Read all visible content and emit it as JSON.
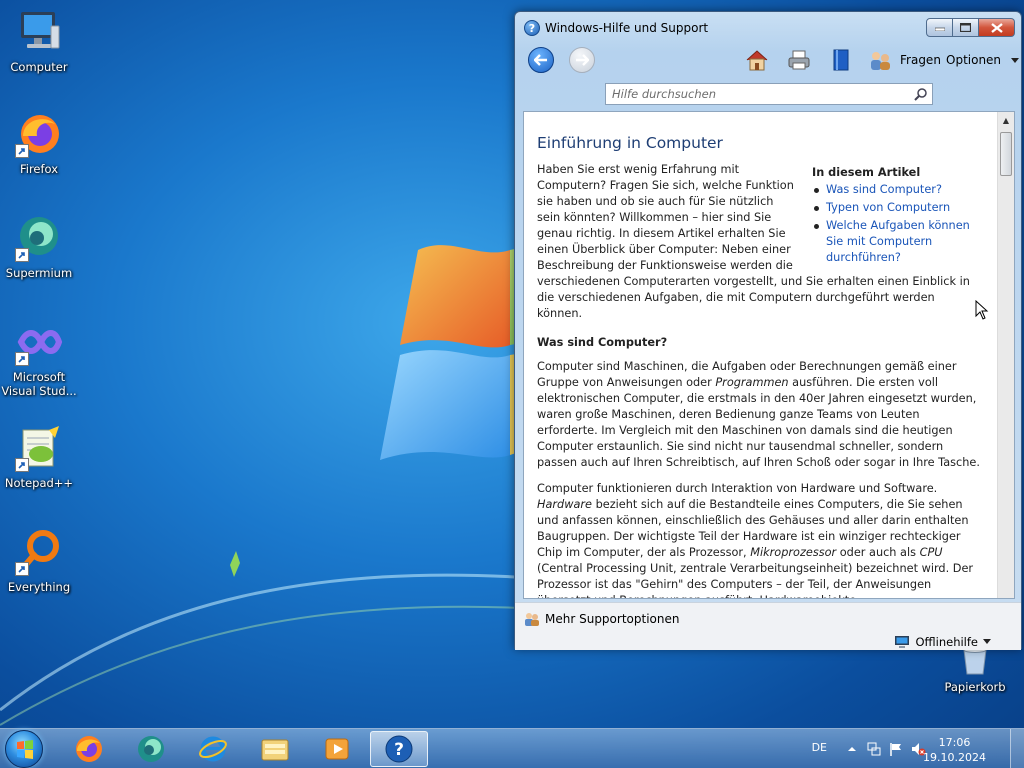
{
  "desktop": {
    "icons": [
      {
        "label": "Computer",
        "icon": "computer-icon"
      },
      {
        "label": "Firefox",
        "icon": "firefox-icon"
      },
      {
        "label": "Supermium",
        "icon": "supermium-icon"
      },
      {
        "label": "Microsoft Visual Stud...",
        "icon": "visual-studio-icon"
      },
      {
        "label": "Notepad++",
        "icon": "notepadpp-icon"
      },
      {
        "label": "Everything",
        "icon": "everything-icon"
      },
      {
        "label": "Papierkorb",
        "icon": "recycle-bin-icon"
      }
    ]
  },
  "window": {
    "title": "Windows-Hilfe und Support",
    "toolbar": {
      "fragen": "Fragen",
      "optionen": "Optionen"
    },
    "search": {
      "placeholder": "Hilfe durchsuchen"
    },
    "article": {
      "title": "Einführung in Computer",
      "intro": "Haben Sie erst wenig Erfahrung mit Computern? Fragen Sie sich, welche Funktion sie haben und ob sie auch für Sie nützlich sein könnten? Willkommen – hier sind Sie genau richtig. In diesem Artikel erhalten Sie einen Überblick über Computer: Neben einer Beschreibung der Funktionsweise werden die verschiedenen Computerarten vorgestellt, und Sie erhalten einen Einblick in die verschiedenen Aufgaben, die mit Computern durchgeführt werden können.",
      "toc_title": "In diesem Artikel",
      "toc": [
        "Was sind Computer?",
        "Typen von Computern",
        "Welche Aufgaben können Sie mit Computern durchführen?"
      ],
      "section1_title": "Was sind Computer?",
      "section1_p1_a": "Computer sind Maschinen, die Aufgaben oder Berechnungen gemäß einer Gruppe von Anweisungen oder ",
      "section1_p1_em": "Programmen",
      "section1_p1_b": " ausführen. Die ersten voll elektronischen Computer, die erstmals in den 40er Jahren eingesetzt wurden, waren große Maschinen, deren Bedienung ganze Teams von Leuten erforderte. Im Vergleich mit den Maschinen von damals sind die heutigen Computer erstaunlich. Sie sind nicht nur tausendmal schneller, sondern passen auch auf Ihren Schreibtisch, auf Ihren Schoß oder sogar in Ihre Tasche.",
      "section1_p2_a": "Computer funktionieren durch Interaktion von Hardware und Software. ",
      "section1_p2_em1": "Hardware",
      "section1_p2_b": " bezieht sich auf die Bestandteile eines Computers, die Sie sehen und anfassen können, einschließlich des Gehäuses und aller darin enthalten Baugruppen. Der wichtigste Teil der Hardware ist ein winziger rechteckiger Chip im Computer, der als Prozessor, ",
      "section1_p2_em2": "Mikroprozessor",
      "section1_p2_c": " oder auch als ",
      "section1_p2_em3": "CPU",
      "section1_p2_d": " (Central Processing Unit, zentrale Verarbeitungseinheit) bezeichnet wird. Der Prozessor ist das \"Gehirn\" des Computers – der Teil, der Anweisungen übersetzt und Berechnungen ausführt. Hardwareobjekte"
    },
    "footer": {
      "support": "Mehr Supportoptionen",
      "offline": "Offlinehilfe"
    }
  },
  "taskbar": {
    "apps": [
      "firefox-icon",
      "supermium-icon",
      "internet-explorer-icon",
      "explorer-icon",
      "media-player-icon",
      "help-icon"
    ],
    "tray": {
      "language": "DE",
      "time": "17:06",
      "date": "19.10.2024"
    }
  },
  "colors": {
    "link": "#1a55b8",
    "title": "#1e3e74",
    "desktop": "#1a78cc"
  }
}
